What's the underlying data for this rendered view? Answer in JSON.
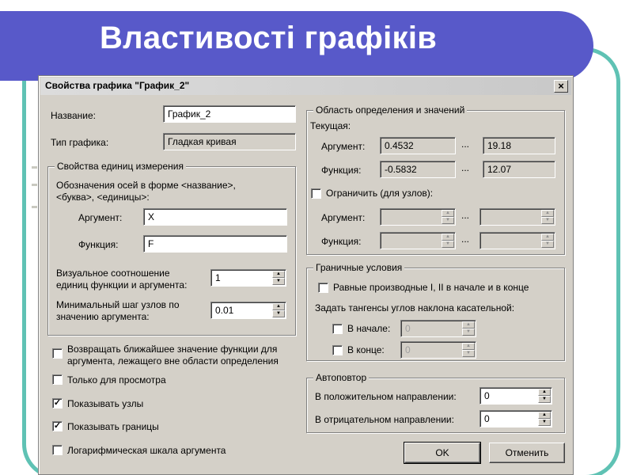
{
  "slide": {
    "title": "Властивості графіків"
  },
  "dialog": {
    "title": "Свойства графика \"График_2\"",
    "close": "×",
    "name_label": "Название:",
    "name_value": "График_2",
    "type_label": "Тип графика:",
    "type_value": "Гладкая кривая",
    "units": {
      "legend": "Свойства единиц измерения",
      "axes_line1": "Обозначения осей в форме <название>,",
      "axes_line2": "<буква>, <единицы>:",
      "arg_label": "Аргумент:",
      "arg_value": "X",
      "func_label": "Функция:",
      "func_value": "F",
      "ratio_line1": "Визуальное соотношение",
      "ratio_line2": "единиц функции и аргумента:",
      "ratio_value": "1",
      "step_line1": "Минимальный шаг узлов по",
      "step_line2": "значению аргумента:",
      "step_value": "0.01"
    },
    "options": [
      {
        "line1": "Возвращать ближайшее значение функции для",
        "line2": "аргумента, лежащего вне области определения",
        "checked": false
      },
      {
        "line1": "Только для просмотра",
        "line2": "",
        "checked": false
      },
      {
        "line1": "Показывать узлы",
        "line2": "",
        "checked": true
      },
      {
        "line1": "Показывать границы",
        "line2": "",
        "checked": true
      },
      {
        "line1": "Логарифмическая шкала аргумента",
        "line2": "",
        "checked": false
      }
    ],
    "domain": {
      "legend": "Область определения и значений",
      "current_label": "Текущая:",
      "arg_label": "Аргумент:",
      "arg_from": "0.4532",
      "arg_to": "19.18",
      "func_label": "Функция:",
      "func_from": "-0.5832",
      "func_to": "12.07",
      "dots": "...",
      "limit_label": "Ограничить (для узлов):",
      "limit_arg_label": "Аргумент:",
      "limit_func_label": "Функция:"
    },
    "boundary": {
      "legend": "Граничные условия",
      "equal_label": "Равные производные I, II в начале и в конце",
      "tangent_label": "Задать тангенсы углов наклона касательной:",
      "start_label": "В начале:",
      "start_value": "0",
      "end_label": "В конце:",
      "end_value": "0"
    },
    "autorepeat": {
      "legend": "Автоповтор",
      "pos_label": "В положительном направлении:",
      "pos_value": "0",
      "neg_label": "В отрицательном направлении:",
      "neg_value": "0"
    },
    "ok_label": "OK",
    "cancel_label": "Отменить"
  }
}
